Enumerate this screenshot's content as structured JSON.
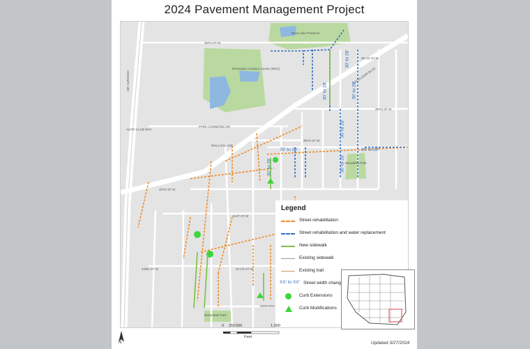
{
  "title": "2024 Pavement Management Project",
  "updated": "Updated 3/27/2024",
  "legend": {
    "title": "Legend",
    "items": [
      {
        "symbol": "dash-orange",
        "label": "Street rehabilitation"
      },
      {
        "symbol": "dash-blue",
        "label": "Street rehabilitation and water replacement"
      },
      {
        "symbol": "green",
        "label": "New sidewalk"
      },
      {
        "symbol": "gray",
        "label": "Existing sidewalk"
      },
      {
        "symbol": "trail",
        "label": "Existing trail"
      },
      {
        "symbol": "text",
        "sample": "XX' to XX'",
        "label": "Street width changes"
      },
      {
        "symbol": "dot",
        "label": "Curb Extensions"
      },
      {
        "symbol": "tri",
        "label": "Curb Modifications"
      }
    ]
  },
  "scale": {
    "ticks": [
      "0",
      "250",
      "500",
      "1,000"
    ],
    "unit": "Feet"
  },
  "north": "N",
  "width_changes": [
    "30' to 28'",
    "30' to 28'",
    "30' to 28'",
    "30' to 28'",
    "30' to 28'",
    "30' to 28'",
    "30' to 28'",
    "30' to 28'"
  ],
  "street_labels": {
    "w36": "36TH ST W",
    "w36half": "36 1/2 ST W",
    "w38": "38TH ST W",
    "w39": "39TH ST W",
    "w40": "40TH ST W",
    "w41": "41ST ST W",
    "w42": "42ND ST W",
    "w42half": "42 1/2 ST W",
    "autoclub": "AUTO CLUB WAY",
    "parkcommons": "PARK COMMONS DR",
    "parkcenter": "PARK CENTER BLVD",
    "parknicollet": "PARK NICOLLET BLVD",
    "wallace": "WALLACE AVE",
    "morningside": "MORNINGSIDE RD",
    "highway": "HIGHWAY 100",
    "excelsior": "EXCELSIOR BLVD",
    "monterey": "MONTEREY DR",
    "wooddale": "WOODDALE AVE",
    "vernon": "VERNON AVE S",
    "utica": "UTICA AVE S",
    "toledo": "TOLEDO AVE S",
    "salem": "SALEM AVE S",
    "quentin": "QUENTIN AVE S",
    "natchez": "NATCHEZ AVE S",
    "lynn": "LYNN AVE S",
    "brookside": "BROOKSIDE AVE S",
    "glenhurst": "GLENHURST AVE S",
    "inglewood": "INGLEWOOD AVE S"
  },
  "place_labels": {
    "roc": "Recreation Outdoor Center (ROC)",
    "bass": "Bass Lake Preserve",
    "browndale": "Browndale Park",
    "wooddalepark": "Wooddale Park"
  },
  "colors": {
    "rehab": "#f08a24",
    "water": "#2c6fc2",
    "sidewalk": "#7bc043",
    "curb": "#3fd43b",
    "park": "#b9d9a0",
    "water_body": "#8fb8e0"
  }
}
